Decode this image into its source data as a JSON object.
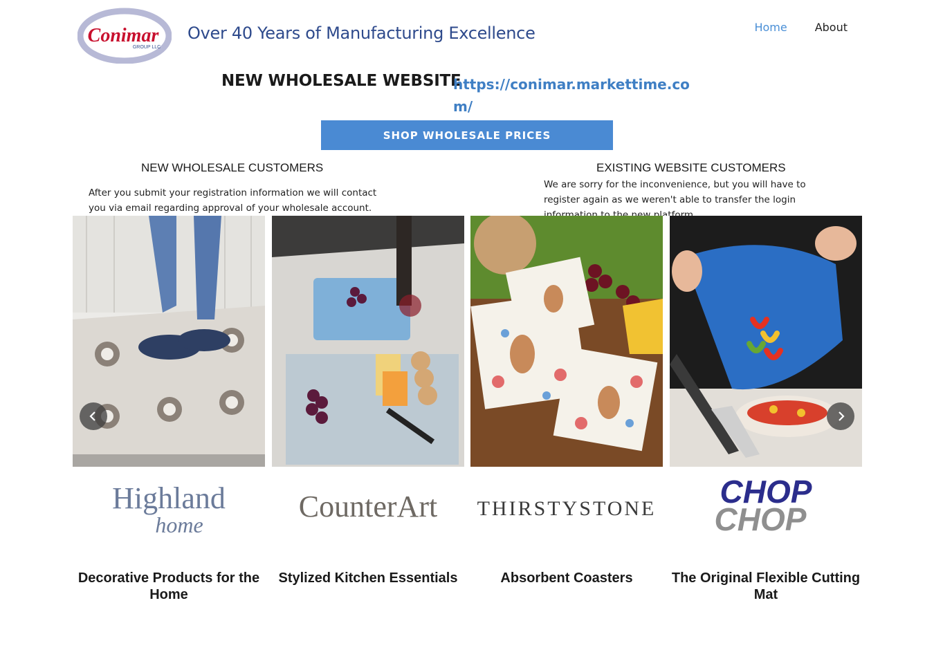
{
  "header": {
    "logo_text": "Conimar",
    "logo_subtext": "GROUP LLC",
    "tagline": "Over 40 Years of Manufacturing Excellence",
    "nav": [
      {
        "label": "Home"
      },
      {
        "label": "About"
      }
    ]
  },
  "wholesale": {
    "title": "NEW WHOLESALE WEBSITE",
    "link": "https://conimar.markettime.com/",
    "button": "SHOP WHOLESALE PRICES"
  },
  "customers": {
    "new_heading": "NEW WHOLESALE CUSTOMERS",
    "new_text": "After you submit your registration information we will contact you via email regarding approval of your wholesale account.",
    "existing_heading": "EXISTING WEBSITE CUSTOMERS",
    "existing_text": "We are sorry for the inconvenience, but you will have to register again as we weren't able to transfer the login information to the new platform."
  },
  "carousel": {
    "prev_icon": "chevron-left-icon",
    "next_icon": "chevron-right-icon",
    "cards": [
      {
        "brand": "Highland",
        "brand_sub": "home",
        "caption": "Decorative Products for the Home"
      },
      {
        "brand": "CounterArt",
        "caption": "Stylized Kitchen Essentials"
      },
      {
        "brand": "THIRSTYSTONE",
        "caption": "Absorbent Coasters"
      },
      {
        "brand": "CHOP",
        "brand_sub": "CHOP",
        "caption": "The Original Flexible Cutting Mat"
      }
    ]
  },
  "colors": {
    "accent": "#4a8ad3",
    "link": "#3f7fc4",
    "brand_red": "#c8102e",
    "brand_navy": "#2e4a8c"
  }
}
